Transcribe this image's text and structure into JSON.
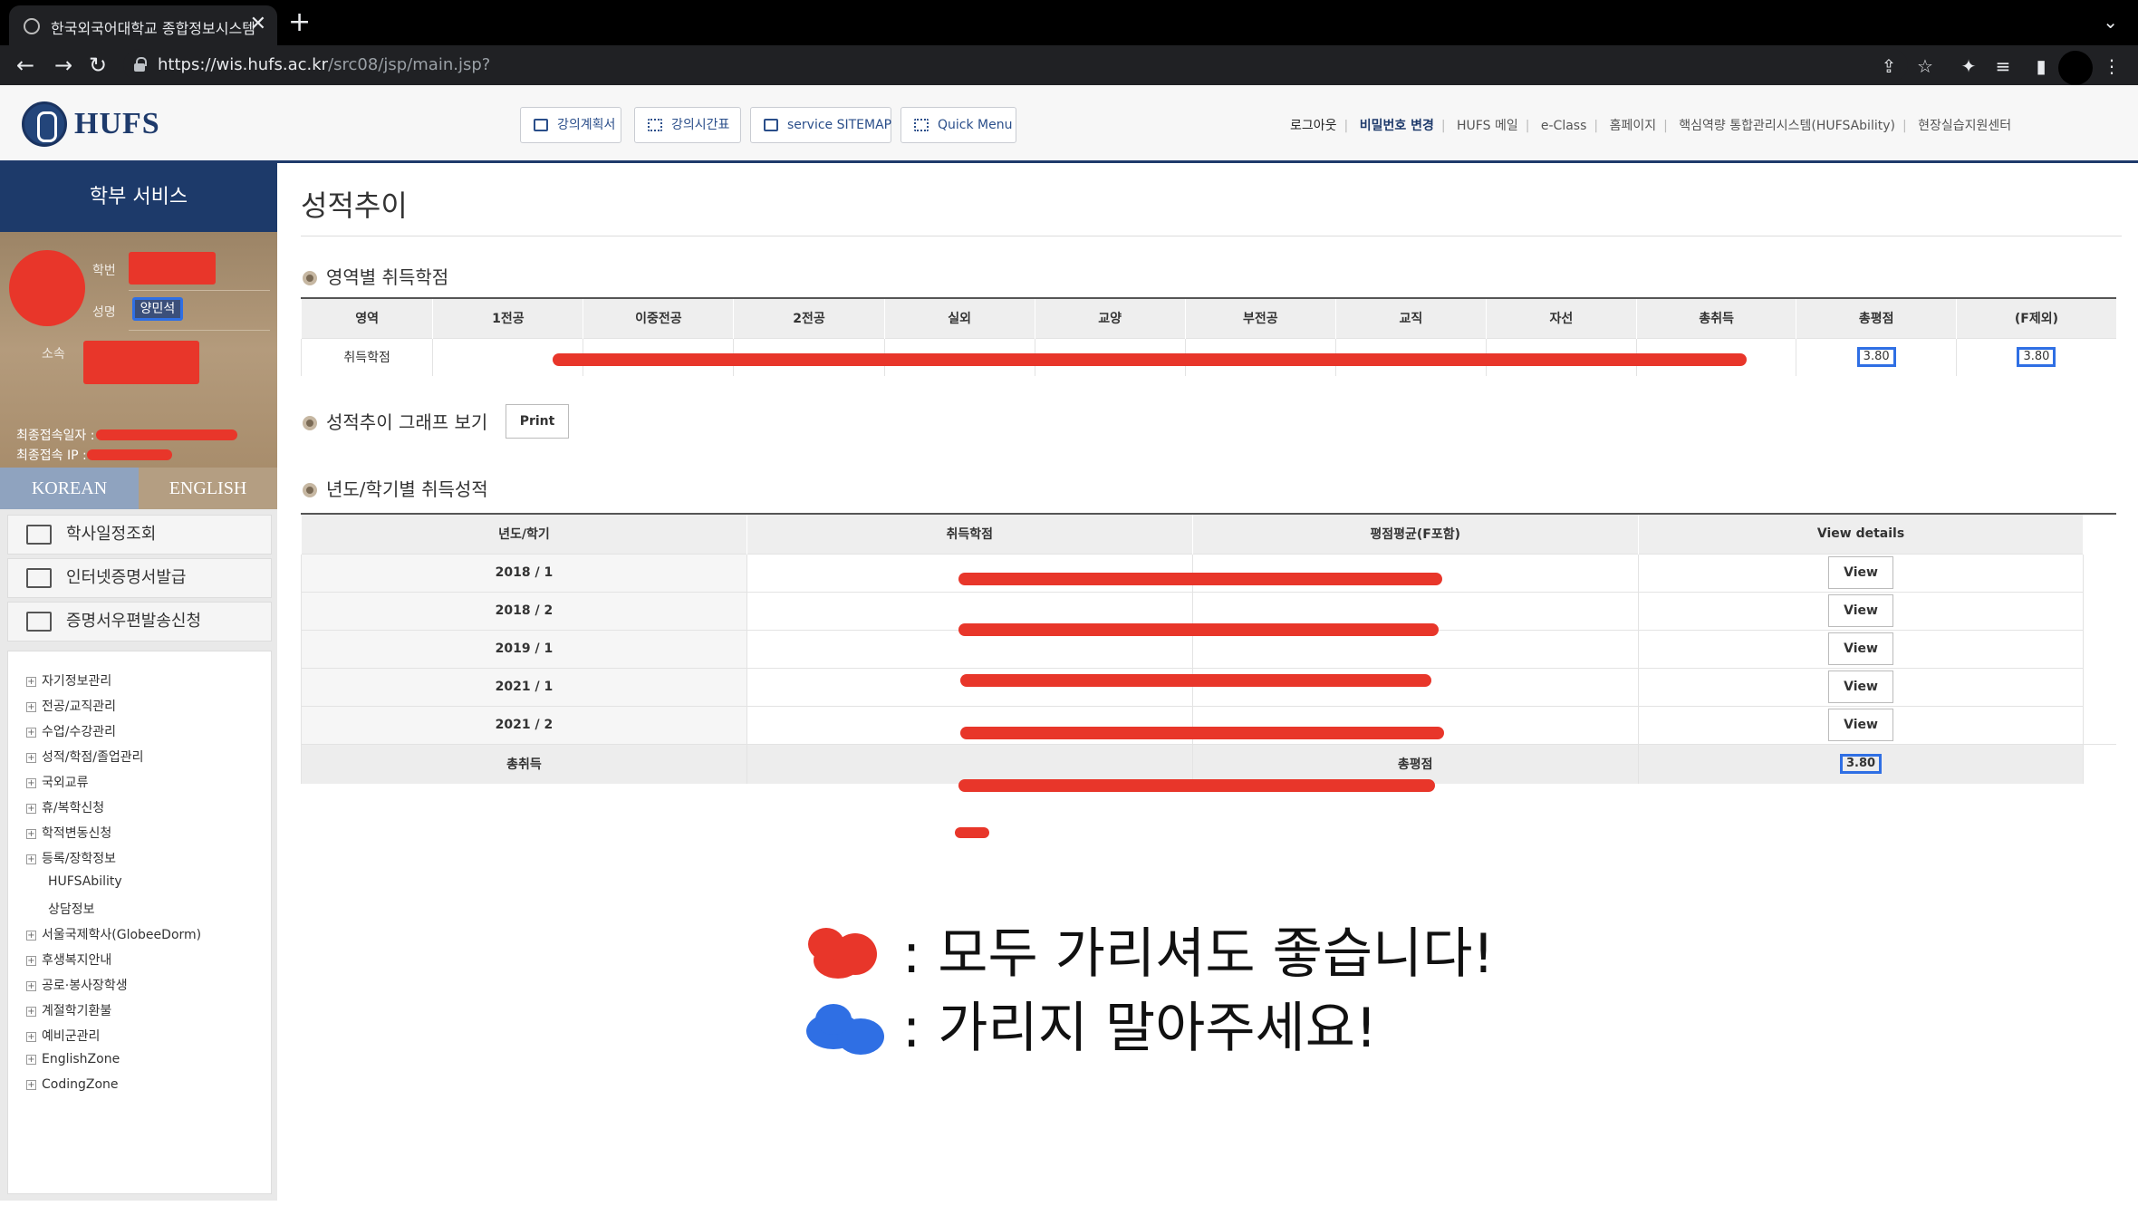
{
  "browser": {
    "tab_title": "한국외국어대학교 종합정보시스템",
    "tab_close": "✕",
    "new_tab": "+",
    "tabs_menu": "⌄",
    "url_host": "https://wis.hufs.ac.kr",
    "url_path": "/src08/jsp/main.jsp?",
    "nav": {
      "back": "←",
      "forward": "→",
      "reload": "↻"
    },
    "icons": {
      "share": "⇪",
      "star": "☆",
      "extensions": "✦",
      "reading_list": "≡",
      "sidepanel": "▮",
      "menu": "⋮"
    }
  },
  "header": {
    "logo_text": "HUFS",
    "buttons": [
      "강의계획서",
      "강의시간표",
      "service SITEMAP",
      "Quick Menu"
    ],
    "links": [
      "로그아웃",
      "비밀번호 변경",
      "HUFS 메일",
      "e-Class",
      "홈페이지",
      "핵심역량 통합관리시스템(HUFSAbility)",
      "현장실습지원센터"
    ]
  },
  "sidebar": {
    "title": "학부 서비스",
    "profile": {
      "student_no_label": "학번",
      "name_label": "성명",
      "name_value": "양민석",
      "dept_label": "소속",
      "last_access_label": "최종접속일자 :",
      "last_ip_label": "최종접속 IP :"
    },
    "lang": {
      "korean": "KOREAN",
      "english": "ENGLISH"
    },
    "quick": [
      "학사일정조회",
      "인터넷증명서발급",
      "증명서우편발송신청"
    ],
    "tree": [
      {
        "label": "자기정보관리",
        "expandable": true
      },
      {
        "label": "전공/교직관리",
        "expandable": true
      },
      {
        "label": "수업/수강관리",
        "expandable": true
      },
      {
        "label": "성적/학점/졸업관리",
        "expandable": true
      },
      {
        "label": "국외교류",
        "expandable": true
      },
      {
        "label": "휴/복학신청",
        "expandable": true
      },
      {
        "label": "학적변동신청",
        "expandable": true
      },
      {
        "label": "등록/장학정보",
        "expandable": true
      },
      {
        "label": "HUFSAbility",
        "expandable": false
      },
      {
        "label": "상담정보",
        "expandable": false
      },
      {
        "label": "서울국제학사(GlobeeDorm)",
        "expandable": true
      },
      {
        "label": "후생복지안내",
        "expandable": true
      },
      {
        "label": "공로·봉사장학생",
        "expandable": true
      },
      {
        "label": "계절학기환불",
        "expandable": true
      },
      {
        "label": "예비군관리",
        "expandable": true
      },
      {
        "label": "EnglishZone",
        "expandable": true
      },
      {
        "label": "CodingZone",
        "expandable": true
      }
    ],
    "tree_expand_glyph": "+"
  },
  "main": {
    "page_title": "성적추이",
    "section1": {
      "title": "영역별 취득학점",
      "columns": [
        "영역",
        "1전공",
        "이중전공",
        "2전공",
        "실외",
        "교양",
        "부전공",
        "교직",
        "자선",
        "총취득",
        "총평점",
        "(F제외)"
      ],
      "row_label": "취득학점",
      "total_gpa": "3.80",
      "gpa_excl_f": "3.80"
    },
    "section2": {
      "title": "성적추이 그래프 보기",
      "print_label": "Print"
    },
    "section3": {
      "title": "년도/학기별 취득성적",
      "columns": [
        "년도/학기",
        "취득학점",
        "평점평균(F포함)",
        "View details"
      ],
      "rows": [
        {
          "term": "2018 / 1",
          "view": "View"
        },
        {
          "term": "2018 / 2",
          "view": "View"
        },
        {
          "term": "2019 / 1",
          "view": "View"
        },
        {
          "term": "2021 / 1",
          "view": "View"
        },
        {
          "term": "2021 / 2",
          "view": "View"
        }
      ],
      "total_label": "총취득",
      "total_gpa_label": "총평점",
      "total_gpa": "3.80"
    },
    "legend": {
      "red_text": ": 모두 가리셔도 좋습니다!",
      "blue_text": ": 가리지 말아주세요!",
      "red_color": "#e8362a",
      "blue_color": "#2f6fe4"
    }
  }
}
